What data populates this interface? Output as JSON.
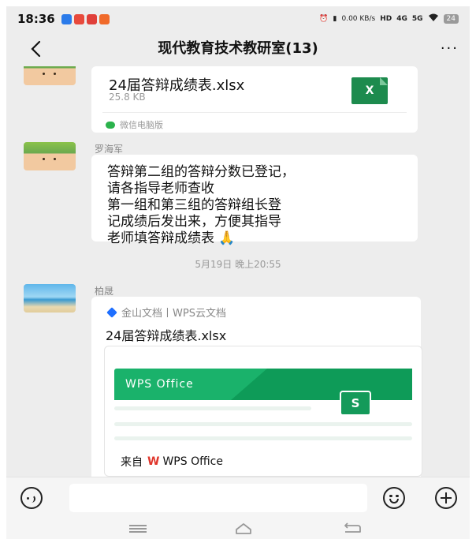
{
  "status_bar": {
    "time": "18:36",
    "net_speed_top": "0.00",
    "net_speed_unit": "KB/s",
    "hd_label": "HD",
    "signal_4g": "4G",
    "signal_5g": "5G",
    "battery": "24"
  },
  "header": {
    "title": "现代教育技术教研室(13)",
    "more": "···"
  },
  "messages": {
    "file1": {
      "file_name": "24届答辩成绩表.xlsx",
      "file_size": "25.8 KB",
      "excel_glyph": "X",
      "source": "微信电脑版"
    },
    "text1": {
      "sender": "罗海军",
      "lines": [
        "答辩第二组的答辩分数已登记，",
        "请各指导老师查收",
        "第一组和第三组的答辩组长登",
        "记成绩后发出来，方便其指导",
        "老师填答辩成绩表"
      ],
      "emoji": "🙏"
    },
    "timestamp": "5月19日 晚上20:55",
    "wps_card": {
      "sender": "柏晟",
      "source": "金山文档丨WPS云文档",
      "file_name": "24届答辩成绩表.xlsx",
      "banner_text": "WPS Office",
      "badge": "S",
      "from_label": "来自",
      "from_logo": "W",
      "from_app": "WPS Office"
    }
  },
  "colors": {
    "excel_green": "#1d8b4e",
    "wps_green": "#1ab26b",
    "wps_red": "#e0352b",
    "chat_bg": "#ededed"
  }
}
